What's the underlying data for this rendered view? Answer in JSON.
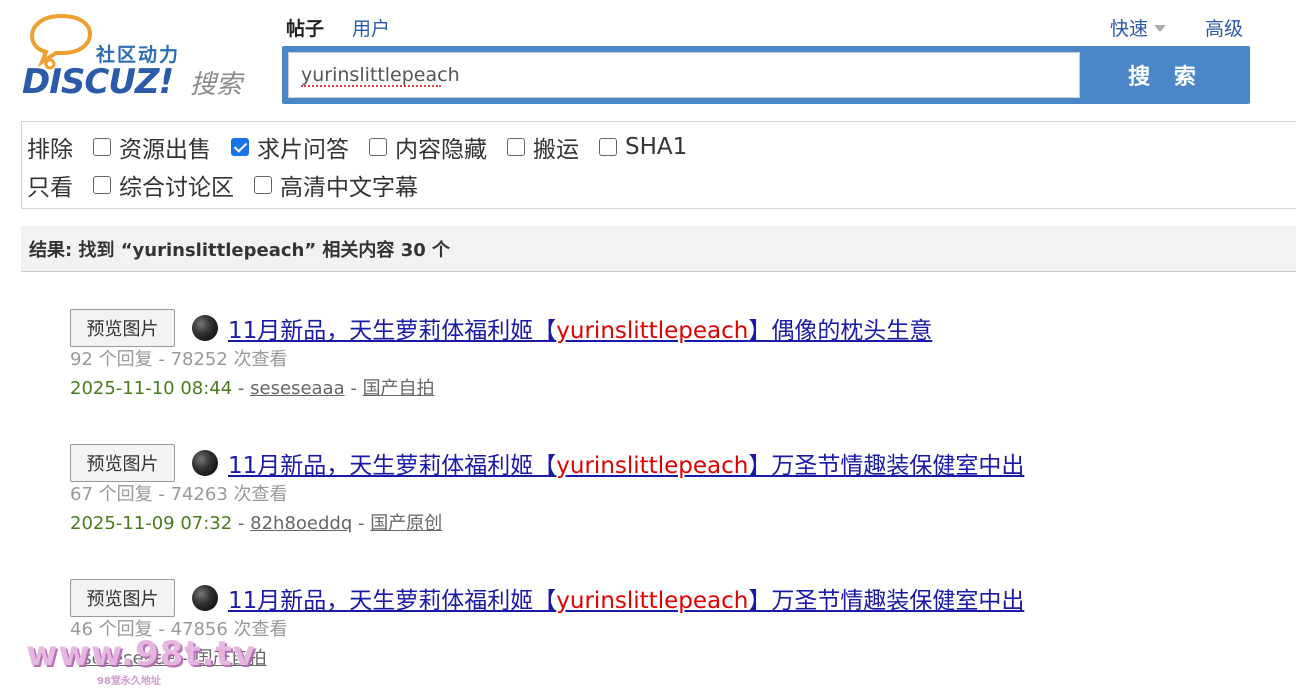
{
  "logo": {
    "brand_cn": "社区动力",
    "brand_main": "DISCUZ!",
    "brand_search": "搜索"
  },
  "tabs": [
    {
      "label": "帖子",
      "active": true
    },
    {
      "label": "用户",
      "active": false
    }
  ],
  "header_right": {
    "quick_label": "快速",
    "advanced_label": "高级"
  },
  "search": {
    "value": "yurinslittlepeach",
    "button_label": "搜 索"
  },
  "filters": {
    "exclude_label": "排除",
    "exclude_options": [
      {
        "label": "资源出售",
        "checked": false
      },
      {
        "label": "求片问答",
        "checked": true
      },
      {
        "label": "内容隐藏",
        "checked": false
      },
      {
        "label": "搬运",
        "checked": false
      },
      {
        "label": "SHA1",
        "checked": false
      }
    ],
    "only_label": "只看",
    "only_options": [
      {
        "label": "综合讨论区",
        "checked": false
      },
      {
        "label": "高清中文字幕",
        "checked": false
      }
    ]
  },
  "result_summary": "结果: 找到 “yurinslittlepeach” 相关内容 30 个",
  "results": [
    {
      "preview_label": "预览图片",
      "title_before": "11月新品，天生萝莉体福利姬【",
      "keyword": "yurinslittlepeach",
      "title_after": "】偶像的枕头生意",
      "stats": "92 个回复 - 78252 次查看",
      "date": "2025-11-10 08:44",
      "author": "seseseaaa",
      "forum": "国产自拍"
    },
    {
      "preview_label": "预览图片",
      "title_before": "11月新品，天生萝莉体福利姬【",
      "keyword": "yurinslittlepeach",
      "title_after": "】万圣节情趣装保健室中出",
      "stats": "67 个回复 - 74263 次查看",
      "date": "2025-11-09 07:32",
      "author": "82h8oeddq",
      "forum": "国产原创"
    },
    {
      "preview_label": "预览图片",
      "title_before": "11月新品，天生萝莉体福利姬【",
      "keyword": "yurinslittlepeach",
      "title_after": "】万圣节情趣装保健室中出",
      "stats": "46 个回复 - 47856 次查看",
      "date": "",
      "author": "seseseaaa",
      "forum": "国产自拍"
    }
  ],
  "separator": " - ",
  "watermark": {
    "text": "www.98t.tv",
    "sub": "98堂永久地址"
  },
  "colors": {
    "accent": "#4a86c8",
    "link": "#1a1aa6",
    "keyword": "#e00000",
    "date": "#4b7a1e"
  }
}
